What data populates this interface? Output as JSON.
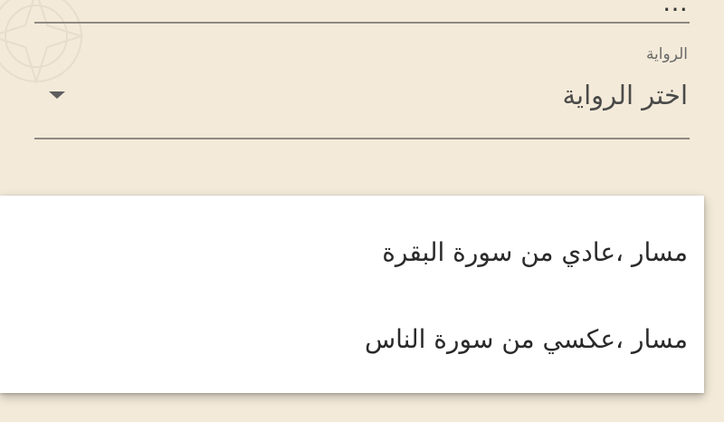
{
  "top_field": {
    "value_partial": "…"
  },
  "riwaya_field": {
    "label": "الرواية",
    "placeholder": "اختر الرواية",
    "arrow_icon": "arrow-drop-down-icon"
  },
  "menu": {
    "items": [
      {
        "label": "مسار ،عادي من سورة البقرة"
      },
      {
        "label": "مسار ،عكسي من سورة الناس"
      }
    ]
  },
  "colors": {
    "background": "#f3ead9",
    "menu_background": "#ffffff",
    "text_primary": "#2a2a2a",
    "text_secondary": "#6b6b6b",
    "underline": "#8d8a83"
  }
}
